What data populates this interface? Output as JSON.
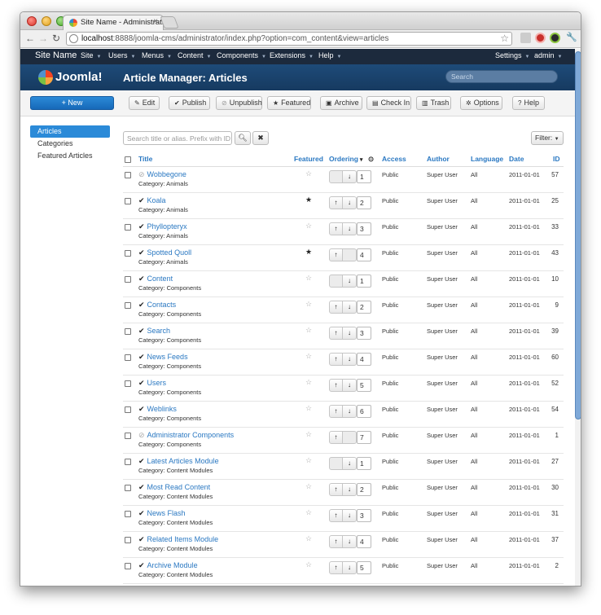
{
  "browser": {
    "tab_title": "Site Name - Administration",
    "url_host": "localhost",
    "url_rest": ":8888/joomla-cms/administrator/index.php?option=com_content&view=articles"
  },
  "navbar": {
    "brand": "Site Name",
    "menus": [
      "Site",
      "Users",
      "Menus",
      "Content",
      "Components",
      "Extensions",
      "Help"
    ],
    "right": [
      "Settings",
      "admin"
    ]
  },
  "header": {
    "logo": "Joomla!",
    "title": "Article Manager: Articles",
    "search_placeholder": "Search"
  },
  "toolbar": {
    "new": "New",
    "buttons": [
      {
        "label": "Edit",
        "icon": "✎"
      },
      {
        "label": "Publish",
        "icon": "✔"
      },
      {
        "label": "Unpublish",
        "icon": "⊘"
      },
      {
        "label": "Featured",
        "icon": "★"
      },
      {
        "label": "Archive",
        "icon": "▣"
      },
      {
        "label": "Check In",
        "icon": "▤"
      },
      {
        "label": "Trash",
        "icon": "▥"
      },
      {
        "label": "Options",
        "icon": "✲"
      },
      {
        "label": "Help",
        "icon": "?"
      }
    ]
  },
  "sidebar": {
    "items": [
      "Articles",
      "Categories",
      "Featured Articles"
    ]
  },
  "filter": {
    "search_placeholder": "Search title or alias. Prefix with ID: to",
    "search_icon": "search-icon",
    "clear_icon": "clear-icon",
    "filter_label": "Filter:"
  },
  "columns": {
    "title": "Title",
    "featured": "Featured",
    "ordering": "Ordering",
    "access": "Access",
    "author": "Author",
    "language": "Language",
    "date": "Date",
    "id": "ID"
  },
  "articles": [
    {
      "title": "Wobbegone",
      "category": "Category: Animals",
      "published": false,
      "featured": false,
      "up": false,
      "down": true,
      "order": "1",
      "access": "Public",
      "author": "Super User",
      "language": "All",
      "date": "2011-01-01",
      "id": "57"
    },
    {
      "title": "Koala",
      "category": "Category: Animals",
      "published": true,
      "featured": true,
      "up": true,
      "down": true,
      "order": "2",
      "access": "Public",
      "author": "Super User",
      "language": "All",
      "date": "2011-01-01",
      "id": "25"
    },
    {
      "title": "Phyllopteryx",
      "category": "Category: Animals",
      "published": true,
      "featured": false,
      "up": true,
      "down": true,
      "order": "3",
      "access": "Public",
      "author": "Super User",
      "language": "All",
      "date": "2011-01-01",
      "id": "33"
    },
    {
      "title": "Spotted Quoll",
      "category": "Category: Animals",
      "published": true,
      "featured": true,
      "up": true,
      "down": false,
      "order": "4",
      "access": "Public",
      "author": "Super User",
      "language": "All",
      "date": "2011-01-01",
      "id": "43"
    },
    {
      "title": "Content",
      "category": "Category: Components",
      "published": true,
      "featured": false,
      "up": false,
      "down": true,
      "order": "1",
      "access": "Public",
      "author": "Super User",
      "language": "All",
      "date": "2011-01-01",
      "id": "10"
    },
    {
      "title": "Contacts",
      "category": "Category: Components",
      "published": true,
      "featured": false,
      "up": true,
      "down": true,
      "order": "2",
      "access": "Public",
      "author": "Super User",
      "language": "All",
      "date": "2011-01-01",
      "id": "9"
    },
    {
      "title": "Search",
      "category": "Category: Components",
      "published": true,
      "featured": false,
      "up": true,
      "down": true,
      "order": "3",
      "access": "Public",
      "author": "Super User",
      "language": "All",
      "date": "2011-01-01",
      "id": "39"
    },
    {
      "title": "News Feeds",
      "category": "Category: Components",
      "published": true,
      "featured": false,
      "up": true,
      "down": true,
      "order": "4",
      "access": "Public",
      "author": "Super User",
      "language": "All",
      "date": "2011-01-01",
      "id": "60"
    },
    {
      "title": "Users",
      "category": "Category: Components",
      "published": true,
      "featured": false,
      "up": true,
      "down": true,
      "order": "5",
      "access": "Public",
      "author": "Super User",
      "language": "All",
      "date": "2011-01-01",
      "id": "52"
    },
    {
      "title": "Weblinks",
      "category": "Category: Components",
      "published": true,
      "featured": false,
      "up": true,
      "down": true,
      "order": "6",
      "access": "Public",
      "author": "Super User",
      "language": "All",
      "date": "2011-01-01",
      "id": "54"
    },
    {
      "title": "Administrator Components",
      "category": "Category: Components",
      "published": false,
      "featured": false,
      "up": true,
      "down": false,
      "order": "7",
      "access": "Public",
      "author": "Super User",
      "language": "All",
      "date": "2011-01-01",
      "id": "1"
    },
    {
      "title": "Latest Articles Module",
      "category": "Category: Content Modules",
      "published": true,
      "featured": false,
      "up": false,
      "down": true,
      "order": "1",
      "access": "Public",
      "author": "Super User",
      "language": "All",
      "date": "2011-01-01",
      "id": "27"
    },
    {
      "title": "Most Read Content",
      "category": "Category: Content Modules",
      "published": true,
      "featured": false,
      "up": true,
      "down": true,
      "order": "2",
      "access": "Public",
      "author": "Super User",
      "language": "All",
      "date": "2011-01-01",
      "id": "30"
    },
    {
      "title": "News Flash",
      "category": "Category: Content Modules",
      "published": true,
      "featured": false,
      "up": true,
      "down": true,
      "order": "3",
      "access": "Public",
      "author": "Super User",
      "language": "All",
      "date": "2011-01-01",
      "id": "31"
    },
    {
      "title": "Related Items Module",
      "category": "Category: Content Modules",
      "published": true,
      "featured": false,
      "up": true,
      "down": true,
      "order": "4",
      "access": "Public",
      "author": "Super User",
      "language": "All",
      "date": "2011-01-01",
      "id": "37"
    },
    {
      "title": "Archive Module",
      "category": "Category: Content Modules",
      "published": true,
      "featured": false,
      "up": true,
      "down": true,
      "order": "5",
      "access": "Public",
      "author": "Super User",
      "language": "All",
      "date": "2011-01-01",
      "id": "2"
    }
  ],
  "colors": {
    "accent": "#2a78c2",
    "navbar": "#1c2a3d",
    "header": "#1e4b79"
  }
}
